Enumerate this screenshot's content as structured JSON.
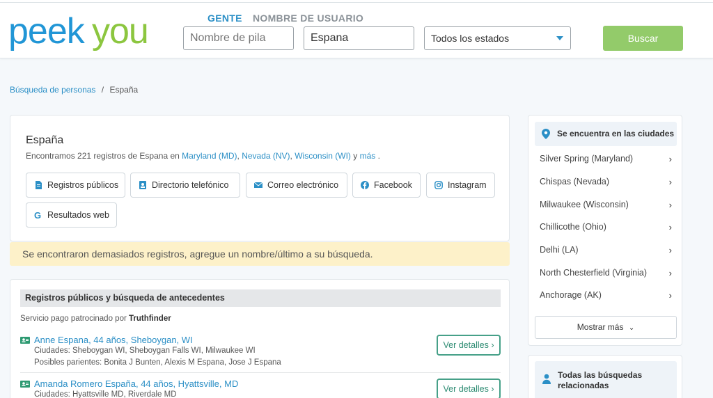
{
  "brand": {
    "logo_text": "peekyou",
    "logo_color_peek": "#2196d6",
    "logo_color_you": "#8cc63f"
  },
  "search": {
    "tab_people": "GENTE",
    "tab_username": "NOMBRE DE USUARIO",
    "first_name_placeholder": "Nombre de pila",
    "last_name_value": "Espana",
    "state_value": "Todos los estados",
    "search_button": "Buscar"
  },
  "breadcrumb": {
    "home": "Búsqueda de personas",
    "separator": "/",
    "current": "España"
  },
  "summary": {
    "title": "España",
    "desc_prefix": "Encontramos 221 registros de Espana en",
    "loc1": "Maryland (MD)",
    "sep1": ",",
    "loc2": "Nevada (NV)",
    "sep2": ",",
    "loc3": "Wisconsin (WI)",
    "and": "y",
    "more": "más",
    "end": ".",
    "buttons": [
      {
        "label": "Registros públicos",
        "icon": "document-icon"
      },
      {
        "label": "Directorio telefónico",
        "icon": "contact-book-icon"
      },
      {
        "label": "Correo electrónico",
        "icon": "envelope-icon"
      },
      {
        "label": "Facebook",
        "icon": "facebook-icon"
      },
      {
        "label": "Instagram",
        "icon": "instagram-icon"
      },
      {
        "label": "Resultados web",
        "icon": "google-icon"
      }
    ]
  },
  "warning": "Se encontraron demasiados registros, agregue un nombre/último a su búsqueda.",
  "records": {
    "header": "Registros públicos y búsqueda de antecedentes",
    "sponsor_prefix": "Servicio pago patrocinado por",
    "sponsor": "Truthfinder",
    "items": [
      {
        "name": "Anne Espana, 44 años, Sheboygan, WI",
        "cities": "Ciudades: Sheboygan WI, Sheboygan Falls WI, Milwaukee WI",
        "relatives": "Posibles parientes: Bonita J Bunten, Alexis M Espana, Jose J Espana",
        "button": "Ver detalles"
      },
      {
        "name": "Amanda Romero España, 44 años, Hyattsville, MD",
        "cities": "Ciudades: Hyattsville MD, Riverdale MD",
        "button": "Ver detalles"
      }
    ]
  },
  "sidebar": {
    "cities_header": "Se encuentra en las ciudades",
    "cities": [
      "Silver Spring (Maryland)",
      "Chispas (Nevada)",
      "Milwaukee (Wisconsin)",
      "Chillicothe (Ohio)",
      "Delhi (LA)",
      "North Chesterfield (Virginia)",
      "Anchorage (AK)"
    ],
    "show_more": "Mostrar más",
    "related": "Todas las búsquedas relacionadas"
  }
}
